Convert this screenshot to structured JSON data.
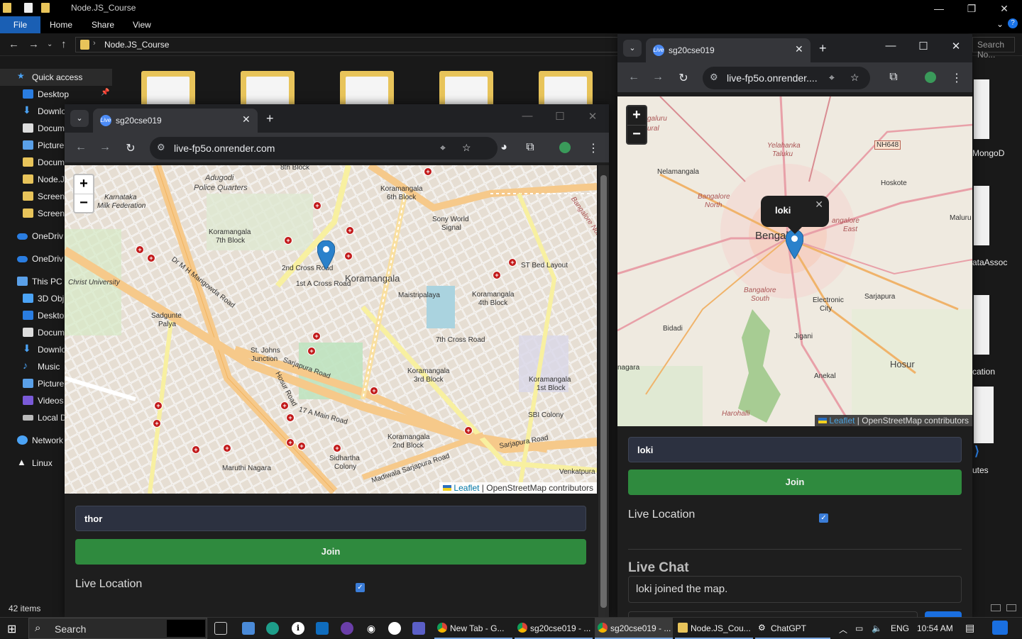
{
  "explorer": {
    "title": "Node.JS_Course",
    "ribbon": {
      "file": "File",
      "home": "Home",
      "share": "Share",
      "view": "View"
    },
    "path": "Node.JS_Course",
    "search_placeholder": "Search No...",
    "nav": [
      {
        "label": "Quick access"
      },
      {
        "label": "Desktop"
      },
      {
        "label": "Downlo"
      },
      {
        "label": "Docum"
      },
      {
        "label": "Picture"
      },
      {
        "label": "Docum"
      },
      {
        "label": "Node.J"
      },
      {
        "label": "Screens"
      },
      {
        "label": "Screen"
      },
      {
        "label": "OneDriv"
      },
      {
        "label": "OneDriv"
      },
      {
        "label": "This PC"
      },
      {
        "label": "3D Obj"
      },
      {
        "label": "Deskto"
      },
      {
        "label": "Docum"
      },
      {
        "label": "Downlo"
      },
      {
        "label": "Music"
      },
      {
        "label": "Picture"
      },
      {
        "label": "Videos"
      },
      {
        "label": "Local D"
      },
      {
        "label": "Network"
      },
      {
        "label": "Linux"
      }
    ],
    "right_labels": [
      "MongoD",
      "ataAssoc",
      "cation",
      "utes"
    ],
    "status": "42 items"
  },
  "chrome_left": {
    "tab_title": "sg20cse019",
    "url": "live-fp5o.onrender.com",
    "map": {
      "labels": [
        "8th Block",
        "Adugodi",
        "Police Quarters",
        "Karnataka",
        "Milk Federation",
        "Koramangala",
        "7th Block",
        "Koramangala",
        "6th Block",
        "Sony World",
        "Signal",
        "Koramangala",
        "Maistripalaya",
        "Koramangala",
        "4th Block",
        "ST Bed Layout",
        "Christ University",
        "Sadgunte",
        "Palya",
        "St. Johns",
        "Junction",
        "Sarjapura Road",
        "Koramangala",
        "3rd Block",
        "Koramangala",
        "1st Block",
        "SBI Colony",
        "Koramangala",
        "2nd Block",
        "Sidhartha",
        "Colony",
        "Maruthi Nagara",
        "Venkatpura",
        "Sarjapura Road",
        "Madiwala Sarjapura Road",
        "Hosur Road",
        "Dr M H Marigowda Road",
        "7th Cross Road",
        "1st A Cross Road",
        "2nd Cross Road",
        "17 A Main Road",
        "Bangalore North"
      ],
      "attribution_link": "Leaflet",
      "attribution_text": "| OpenStreetMap contributors"
    },
    "name_value": "thor",
    "join_label": "Join",
    "live_label": "Live Location"
  },
  "chrome_right": {
    "tab_title": "sg20cse019",
    "url": "live-fp5o.onrender....",
    "map": {
      "labels": [
        "galuru",
        "ural",
        "Yelahanka",
        "Taluku",
        "NH648",
        "Nelamangala",
        "Hoskote",
        "Bangalore",
        "North",
        "Bengal",
        "Maluru",
        "angalore",
        "East",
        "Bangalore",
        "South",
        "Electronic",
        "City",
        "Sarjapura",
        "Bidadi",
        "Jigani",
        "Hosur",
        "nagara",
        "Anekal",
        "Harohalli"
      ],
      "attribution_link": "Leaflet",
      "attribution_text": "| OpenStreetMap contributors"
    },
    "popup": "loki",
    "name_value": "loki",
    "join_label": "Join",
    "live_label": "Live Location",
    "chat_title": "Live Chat",
    "chat_messages": [
      "loki joined the map."
    ]
  },
  "taskbar": {
    "search": "Search",
    "apps": [
      {
        "label": "New Tab - G..."
      },
      {
        "label": "sg20cse019 - ..."
      },
      {
        "label": "sg20cse019 - ..."
      },
      {
        "label": "Node.JS_Cou..."
      },
      {
        "label": "ChatGPT"
      }
    ],
    "lang": "ENG",
    "time": "10:54 AM"
  },
  "colors": {
    "accent_blue": "#1a5fb4",
    "join_green": "#2f8a3e",
    "hospital_red": "#c21a1a",
    "pin_blue": "#2a81cb"
  }
}
